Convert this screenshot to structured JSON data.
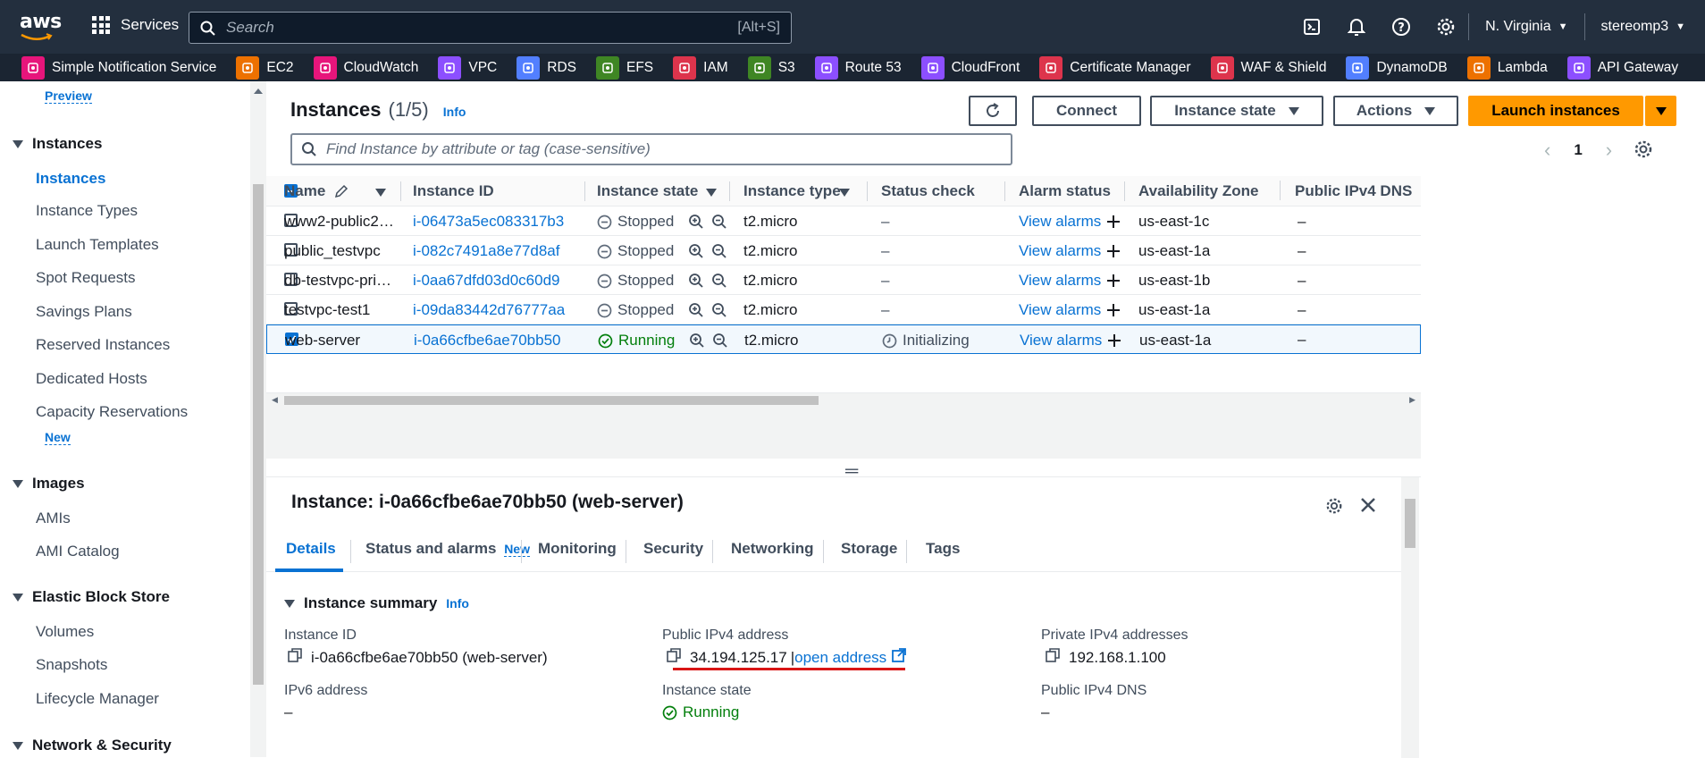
{
  "topbar": {
    "logo": "aws",
    "services_label": "Services",
    "search_placeholder": "Search",
    "search_shortcut": "[Alt+S]",
    "region": "N. Virginia",
    "account": "stereomp3"
  },
  "favorites": [
    {
      "label": "Simple Notification Service",
      "color": "#e7157b",
      "icon": "sns-icon"
    },
    {
      "label": "EC2",
      "color": "#ed7100",
      "icon": "ec2-icon"
    },
    {
      "label": "CloudWatch",
      "color": "#e7157b",
      "icon": "cloudwatch-icon"
    },
    {
      "label": "VPC",
      "color": "#8c4fff",
      "icon": "vpc-icon"
    },
    {
      "label": "RDS",
      "color": "#527fff",
      "icon": "rds-icon"
    },
    {
      "label": "EFS",
      "color": "#3f8624",
      "icon": "efs-icon"
    },
    {
      "label": "IAM",
      "color": "#dd344c",
      "icon": "iam-icon"
    },
    {
      "label": "S3",
      "color": "#3f8624",
      "icon": "s3-icon"
    },
    {
      "label": "Route 53",
      "color": "#8c4fff",
      "icon": "route53-icon"
    },
    {
      "label": "CloudFront",
      "color": "#8c4fff",
      "icon": "cloudfront-icon"
    },
    {
      "label": "Certificate Manager",
      "color": "#dd344c",
      "icon": "acm-icon"
    },
    {
      "label": "WAF & Shield",
      "color": "#dd344c",
      "icon": "waf-icon"
    },
    {
      "label": "DynamoDB",
      "color": "#527fff",
      "icon": "dynamodb-icon"
    },
    {
      "label": "Lambda",
      "color": "#ed7100",
      "icon": "lambda-icon"
    },
    {
      "label": "API Gateway",
      "color": "#8c4fff",
      "icon": "apigateway-icon"
    }
  ],
  "sidebar": {
    "preview": "Preview",
    "sections": [
      {
        "title": "Instances",
        "items": [
          "Instances",
          "Instance Types",
          "Launch Templates",
          "Spot Requests",
          "Savings Plans",
          "Reserved Instances",
          "Dedicated Hosts",
          "Capacity Reservations"
        ],
        "new_badge": "New"
      },
      {
        "title": "Images",
        "items": [
          "AMIs",
          "AMI Catalog"
        ]
      },
      {
        "title": "Elastic Block Store",
        "items": [
          "Volumes",
          "Snapshots",
          "Lifecycle Manager"
        ]
      },
      {
        "title": "Network & Security",
        "items": []
      }
    ]
  },
  "instances_panel": {
    "title": "Instances",
    "count": "(1/5)",
    "info": "Info",
    "buttons": {
      "connect": "Connect",
      "instance_state": "Instance state",
      "actions": "Actions",
      "launch": "Launch instances"
    },
    "search_placeholder": "Find Instance by attribute or tag (case-sensitive)",
    "page": "1",
    "columns": [
      "Name",
      "Instance ID",
      "Instance state",
      "Instance type",
      "Status check",
      "Alarm status",
      "Availability Zone",
      "Public IPv4 DNS"
    ],
    "rows": [
      {
        "name": "www2-public2…",
        "id": "i-06473a5ec083317b3",
        "state": "Stopped",
        "type": "t2.micro",
        "status": "–",
        "alarm": "View alarms",
        "az": "us-east-1c",
        "dns": "–",
        "selected": false
      },
      {
        "name": "public_testvpc",
        "id": "i-082c7491a8e77d8af",
        "state": "Stopped",
        "type": "t2.micro",
        "status": "–",
        "alarm": "View alarms",
        "az": "us-east-1a",
        "dns": "–",
        "selected": false
      },
      {
        "name": "db-testvpc-pri…",
        "id": "i-0aa67dfd03d0c60d9",
        "state": "Stopped",
        "type": "t2.micro",
        "status": "–",
        "alarm": "View alarms",
        "az": "us-east-1b",
        "dns": "–",
        "selected": false
      },
      {
        "name": "testvpc-test1",
        "id": "i-09da83442d76777aa",
        "state": "Stopped",
        "type": "t2.micro",
        "status": "–",
        "alarm": "View alarms",
        "az": "us-east-1a",
        "dns": "–",
        "selected": false
      },
      {
        "name": "web-server",
        "id": "i-0a66cfbe6ae70bb50",
        "state": "Running",
        "type": "t2.micro",
        "status": "Initializing",
        "alarm": "View alarms",
        "az": "us-east-1a",
        "dns": "–",
        "selected": true
      }
    ]
  },
  "detail": {
    "title": "Instance: i-0a66cfbe6ae70bb50 (web-server)",
    "tabs": [
      "Details",
      "Status and alarms",
      "Monitoring",
      "Security",
      "Networking",
      "Storage",
      "Tags"
    ],
    "tab_new": "New",
    "summary_title": "Instance summary",
    "info": "Info",
    "fields": {
      "instance_id_label": "Instance ID",
      "instance_id_value": "i-0a66cfbe6ae70bb50 (web-server)",
      "public_ipv4_label": "Public IPv4 address",
      "public_ipv4_value": "34.194.125.17",
      "open_address": "open address",
      "private_ipv4_label": "Private IPv4 addresses",
      "private_ipv4_value": "192.168.1.100",
      "ipv6_label": "IPv6 address",
      "ipv6_value": "–",
      "state_label": "Instance state",
      "state_value": "Running",
      "public_dns_label": "Public IPv4 DNS",
      "public_dns_value": "–"
    }
  },
  "colors": {
    "accent": "#0972d3",
    "primary_button": "#ff9900",
    "running": "#037f0c",
    "annotation": "#d91515"
  }
}
